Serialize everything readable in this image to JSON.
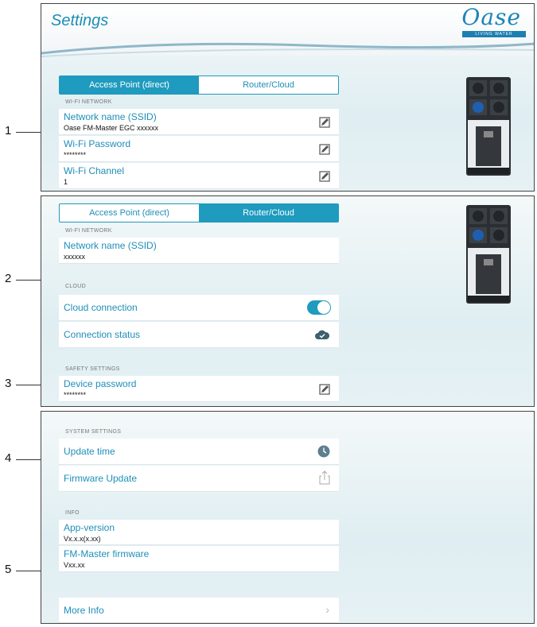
{
  "header": {
    "title": "Settings",
    "logo_text": "Oase",
    "logo_tagline": "LIVING WATER"
  },
  "tabs": {
    "access_point": "Access Point (direct)",
    "router_cloud": "Router/Cloud"
  },
  "panel1": {
    "section": "WI-FI NETWORK",
    "rows": [
      {
        "label": "Network name (SSID)",
        "value": "Oase FM-Master EGC xxxxxx"
      },
      {
        "label": "Wi-Fi Password",
        "value": "********"
      },
      {
        "label": "Wi-Fi Channel",
        "value": "1"
      }
    ]
  },
  "panel2": {
    "section_wifi": "WI-FI NETWORK",
    "ssid_label": "Network name (SSID)",
    "ssid_value": "xxxxxx",
    "section_cloud": "CLOUD",
    "cloud_connection": "Cloud connection",
    "cloud_connection_on": true,
    "connection_status": "Connection status",
    "section_safety": "SAFETY SETTINGS",
    "device_password_label": "Device password",
    "device_password_value": "********"
  },
  "panel3": {
    "section_system": "SYSTEM SETTINGS",
    "update_time": "Update time",
    "firmware_update": "Firmware Update",
    "section_info": "INFO",
    "app_version_label": "App-version",
    "app_version_value": "Vx.x.x(x.xx)",
    "fm_firmware_label": "FM-Master firmware",
    "fm_firmware_value": "Vxx.xx",
    "more_info": "More Info"
  },
  "callouts": [
    "1",
    "2",
    "3",
    "4",
    "5"
  ],
  "colors": {
    "accent": "#1e9bbf",
    "bracket": "#c8302a"
  }
}
